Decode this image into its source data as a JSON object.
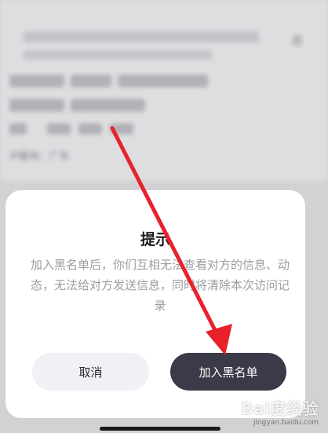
{
  "background": {
    "lines": [
      "███ ████ ███████",
      "█████ █████",
      "██ ███ ██"
    ],
    "right_note": "愿",
    "ip_location": "IP属地：广东"
  },
  "dialog": {
    "title": "提示",
    "body": "加入黑名单后，你们互相无法查看对方的信息、动态，无法给对方发送信息，同时将清除本次访问记录",
    "cancel_label": "取消",
    "confirm_label": "加入黑名单"
  },
  "colors": {
    "confirm_bg": "#3a3a48",
    "cancel_bg": "#f1f1f5",
    "annotation_arrow": "#e8212b"
  },
  "watermark": {
    "main": "Bai度经验",
    "sub": "jingyan.baidu.com"
  },
  "icons": [
    "red-arrow-annotation-icon"
  ]
}
